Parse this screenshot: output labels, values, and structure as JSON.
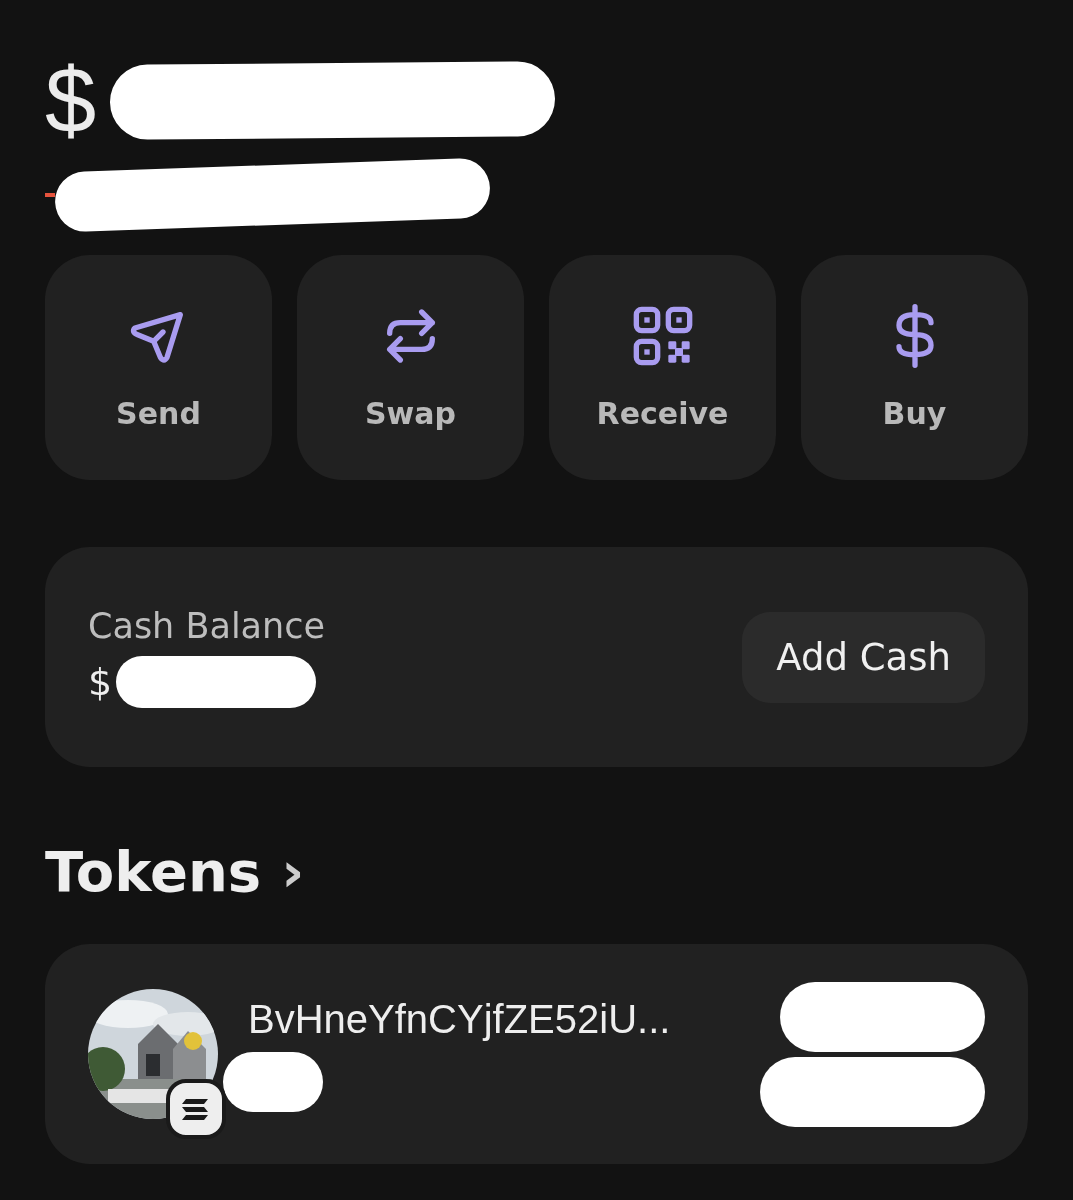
{
  "balance": {
    "currency": "$"
  },
  "actions": [
    {
      "kind": "send",
      "label": "Send"
    },
    {
      "kind": "swap",
      "label": "Swap"
    },
    {
      "kind": "receive",
      "label": "Receive"
    },
    {
      "kind": "buy",
      "label": "Buy"
    }
  ],
  "cash_balance": {
    "label": "Cash Balance",
    "value": "$",
    "button": "Add Cash"
  },
  "tokens": {
    "title": "Tokens",
    "chevron": "›",
    "items": [
      {
        "name": "BvHneYfnCYjfZE52iU..."
      }
    ]
  }
}
